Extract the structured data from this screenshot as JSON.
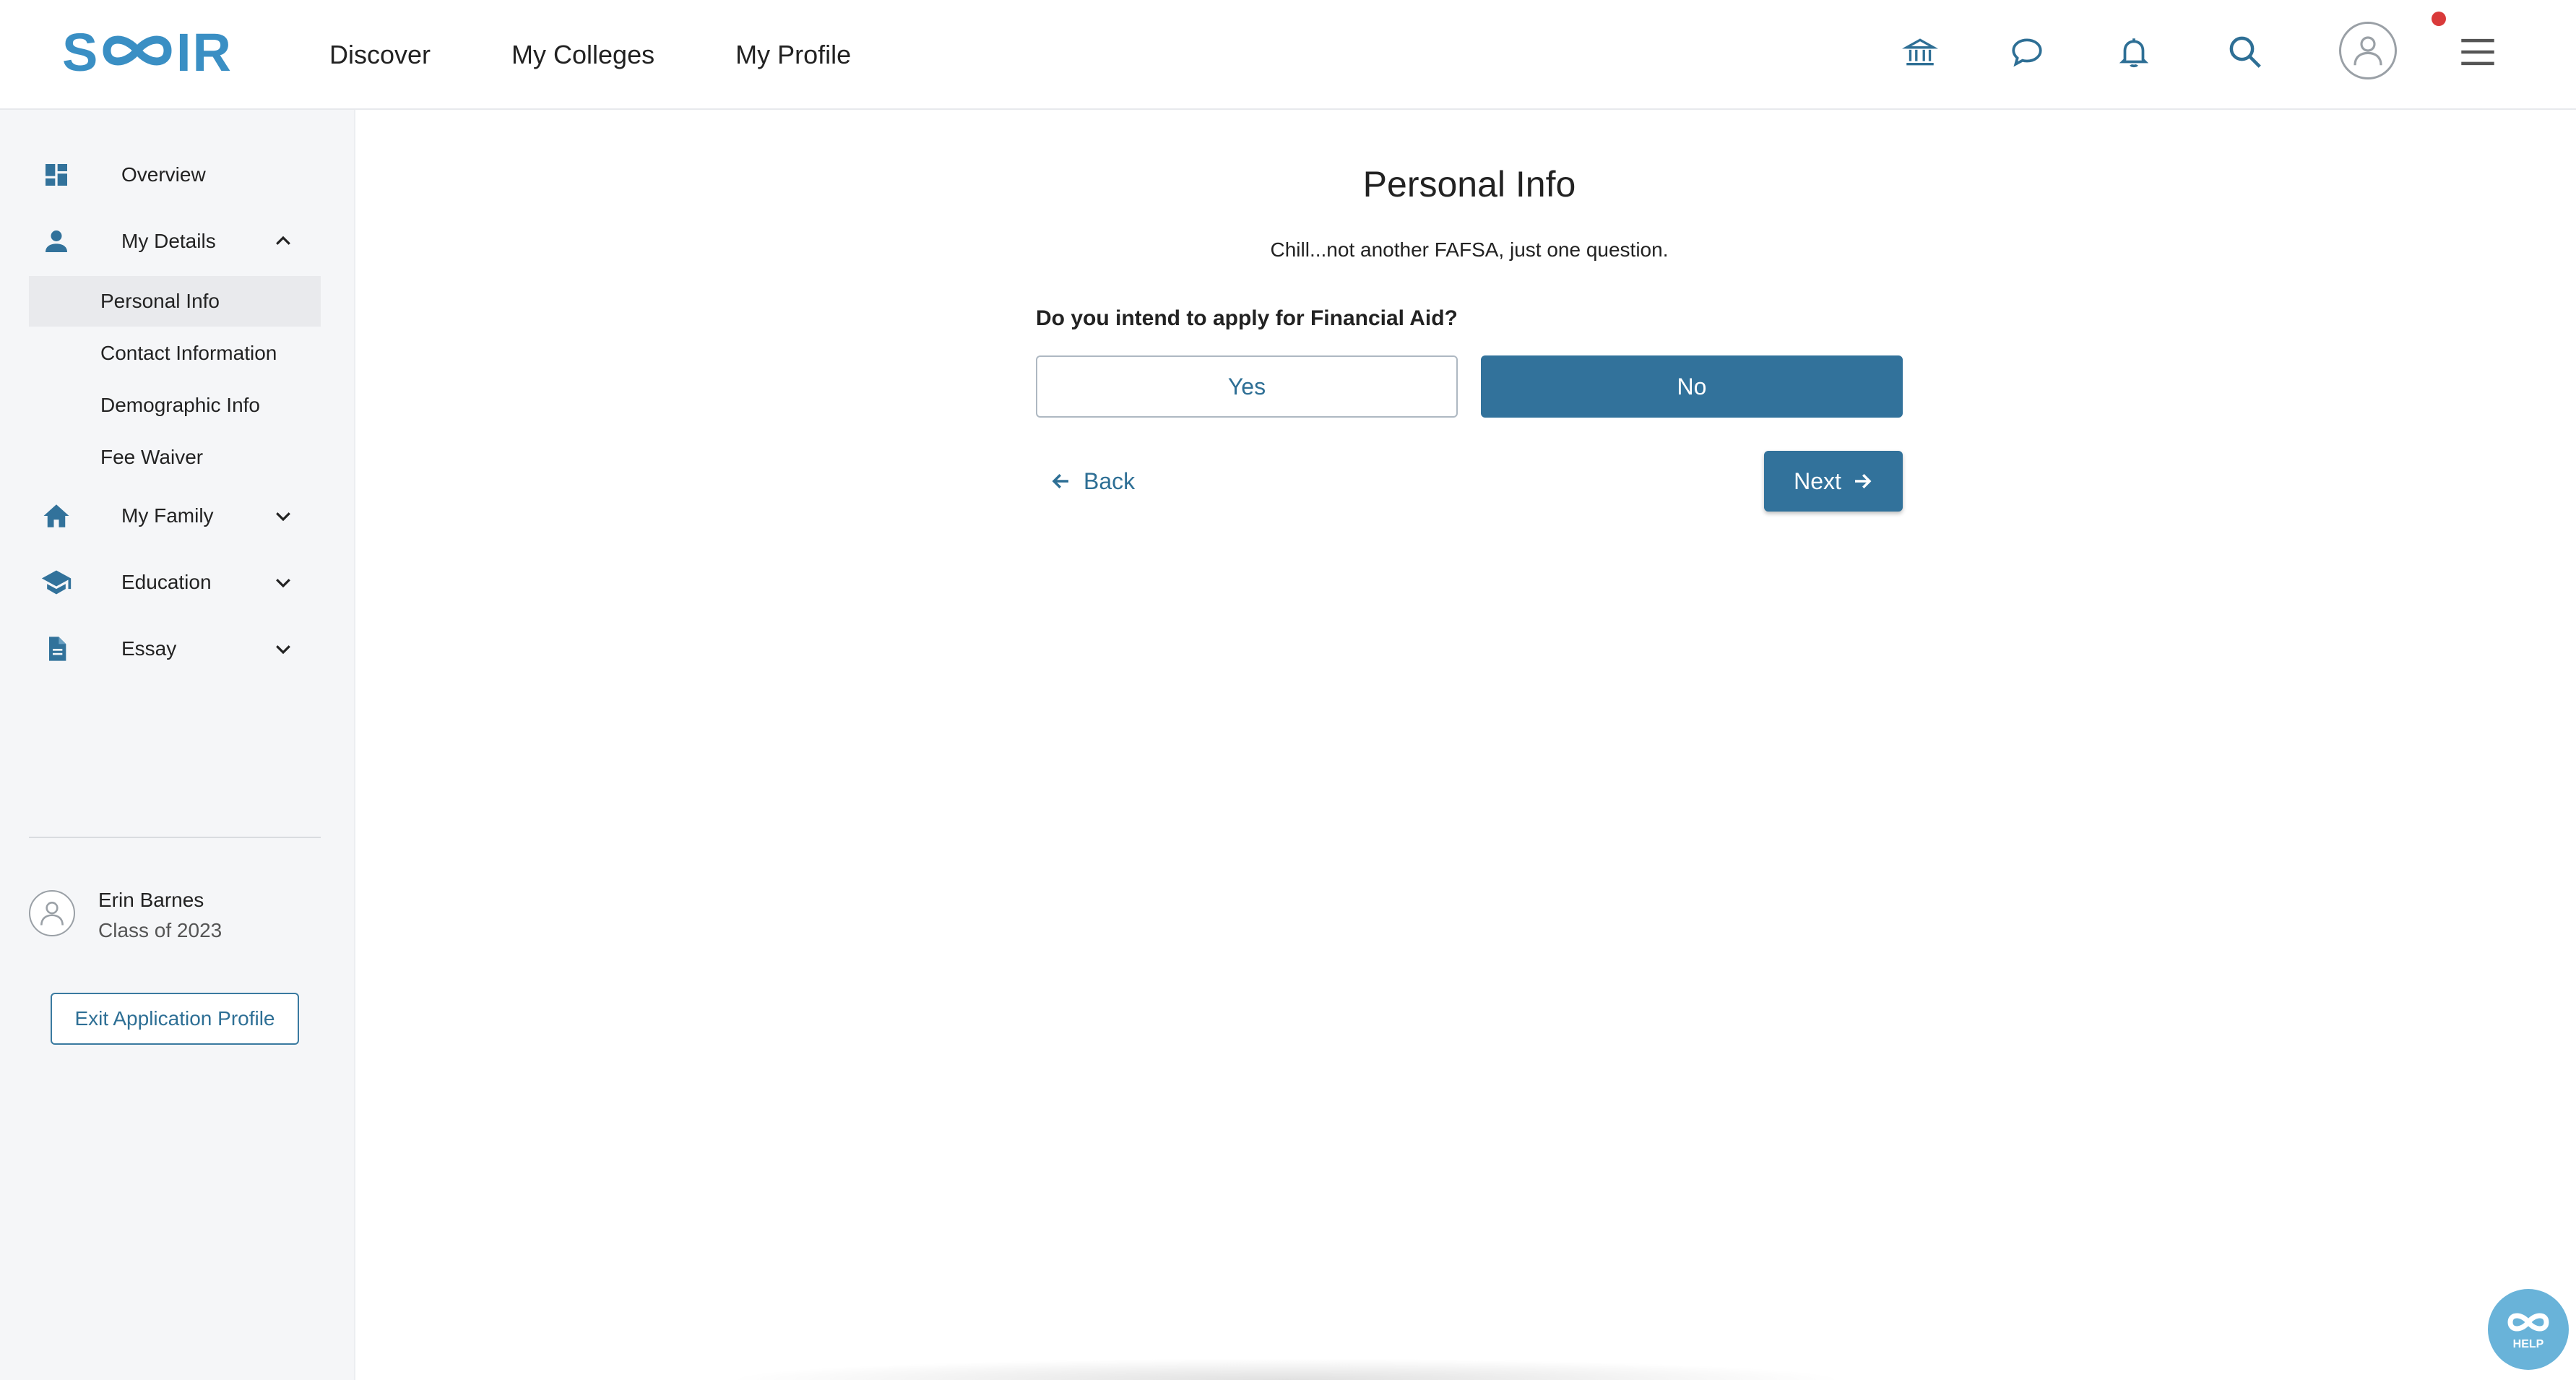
{
  "header": {
    "logo_text": "SCOIR",
    "nav": [
      "Discover",
      "My Colleges",
      "My Profile"
    ],
    "icons": [
      "institution-icon",
      "chat-icon",
      "bell-icon",
      "search-icon",
      "avatar-icon",
      "menu-icon"
    ],
    "notification_dot_color": "#d93a3a"
  },
  "sidebar": {
    "items": [
      {
        "label": "Overview",
        "icon": "dashboard-icon"
      },
      {
        "label": "My Details",
        "icon": "person-icon",
        "expanded": true
      },
      {
        "label": "My Family",
        "icon": "home-icon"
      },
      {
        "label": "Education",
        "icon": "graduation-cap-icon"
      },
      {
        "label": "Essay",
        "icon": "document-icon"
      }
    ],
    "sub_items": [
      "Personal Info",
      "Contact Information",
      "Demographic Info",
      "Fee Waiver"
    ],
    "active_sub_item": "Personal Info",
    "user": {
      "name": "Erin Barnes",
      "class": "Class of 2023"
    },
    "exit_label": "Exit Application Profile"
  },
  "main": {
    "title": "Personal Info",
    "subtitle": "Chill...not another FAFSA, just one question.",
    "question": "Do you intend to apply for Financial Aid?",
    "choices": {
      "yes": "Yes",
      "no": "No"
    },
    "selected_choice": "No",
    "back_label": "Back",
    "next_label": "Next"
  },
  "help": {
    "label": "HELP"
  },
  "colors": {
    "brand": "#3a8fc4",
    "primary": "#32729b",
    "link": "#2e6f95"
  }
}
